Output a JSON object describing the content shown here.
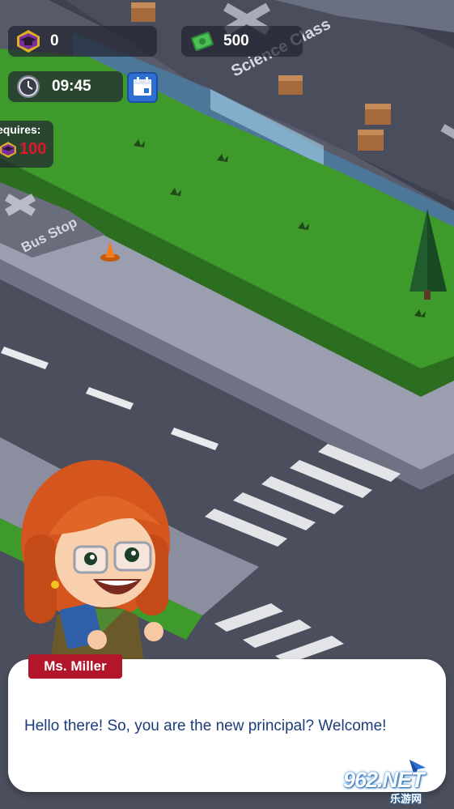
{
  "hud": {
    "graduates": {
      "icon": "graduation-cap-icon",
      "value": "0"
    },
    "money": {
      "icon": "cash-icon",
      "value": "500"
    },
    "clock": {
      "icon": "clock-icon",
      "value": "09:45"
    },
    "calendar": {
      "icon": "calendar-icon"
    }
  },
  "requirement": {
    "label": "equires:",
    "icon": "graduation-cap-icon",
    "value": "100"
  },
  "map": {
    "science_class_label": "Science Class",
    "bus_stop_label": "Bus Stop"
  },
  "dialog": {
    "speaker": "Ms. Miller",
    "message": "Hello there! So, you are the new principal? Welcome!",
    "continue_icon": "arrow-icon"
  },
  "watermark": {
    "main": "962.NET",
    "sub": "乐游网"
  },
  "colors": {
    "grass": "#3f9a2c",
    "road": "#4b4e5c",
    "name_tag": "#b3162b",
    "dialog_text": "#1c3d7a",
    "requirement_value": "#e0182e"
  }
}
